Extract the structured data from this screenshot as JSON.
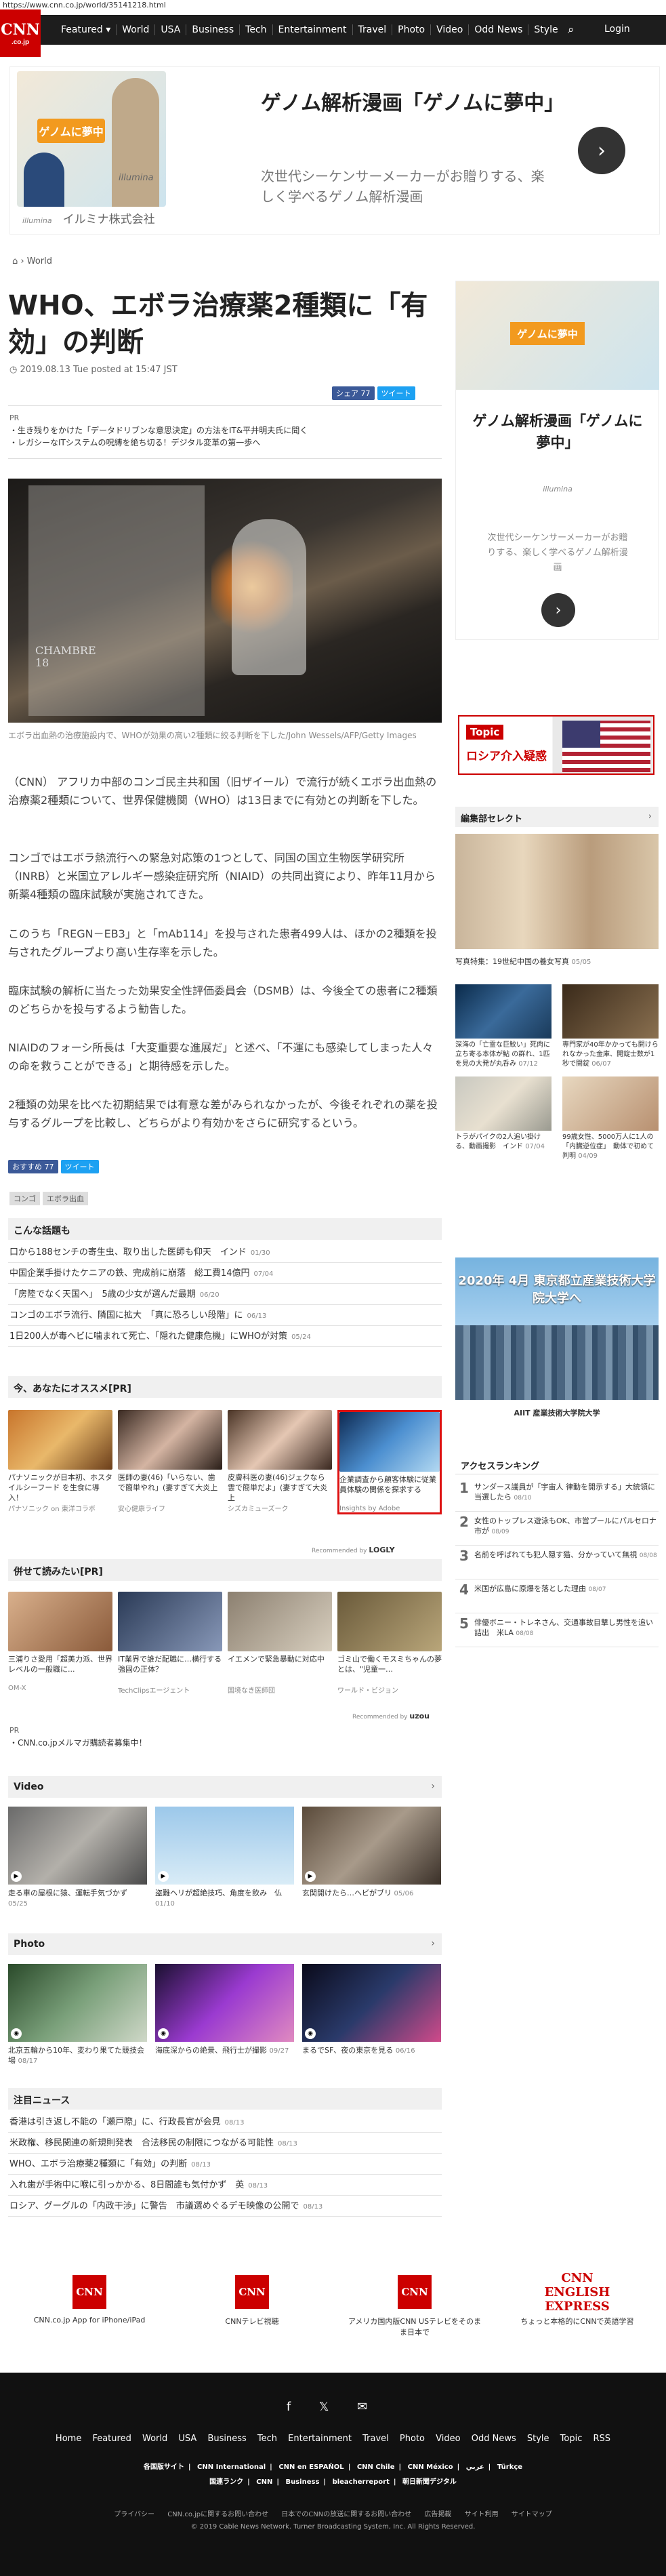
{
  "url": "https://www.cnn.co.jp/world/35141218.html",
  "nav": {
    "logo": "CNN",
    "logo_sub": ".co.jp",
    "links": [
      "Featured ▾",
      "World",
      "USA",
      "Business",
      "Tech",
      "Entertainment",
      "Travel",
      "Photo",
      "Video",
      "Odd News",
      "Style"
    ],
    "login": "Login"
  },
  "top_ad": {
    "banner": "ゲノムに夢中",
    "illumina": "illumina",
    "title": "ゲノム解析漫画「ゲノムに夢中」",
    "desc": "次世代シーケンサーメーカーがお贈りする、楽しく学べるゲノム解析漫画",
    "brand_small": "illumina",
    "brand": "イルミナ株式会社"
  },
  "breadcrumb": "World",
  "article": {
    "title": "WHO、エボラ治療薬2種類に「有効」の判断",
    "date": "2019.08.13 Tue posted at 15:47 JST",
    "share_fb": "シェア 77",
    "share_tw": "ツイート",
    "pr_label": "PR",
    "pr_items": [
      "・生き残りをかけた「データドリブンな意思決定」の方法をIT&平井明夫氏に聞く",
      "・レガシーなITシステムの呪縛を絶ち切る！デジタル変革の第一歩へ"
    ],
    "photo_text": "CHAMBRE\n18",
    "caption": "エボラ出血熱の治療施設内で、WHOが効果の高い2種類に絞る判断を下した/John Wessels/AFP/Getty Images",
    "paragraphs": [
      "（CNN） アフリカ中部のコンゴ民主共和国（旧ザイール）で流行が続くエボラ出血熱の治療薬2種類について、世界保健機関（WHO）は13日までに有効との判断を下した。",
      "コンゴではエボラ熱流行への緊急対応策の1つとして、同国の国立生物医学研究所（INRB）と米国立アレルギー感染症研究所（NIAID）の共同出資により、昨年11月から新薬4種類の臨床試験が実施されてきた。",
      "このうち「REGN－EB3」と「mAb114」を投与された患者499人は、ほかの2種類を投与されたグループより高い生存率を示した。",
      "臨床試験の解析に当たった効果安全性評価委員会（DSMB）は、今後全ての患者に2種類のどちらかを投与するよう勧告した。",
      "NIAIDのフォーシ所長は「大変重要な進展だ」と述べ、「不運にも感染してしまった人々の命を救うことができる」と期待感を示した。",
      "2種類の効果を比べた初期結果では有意な差がみられなかったが、今後それぞれの薬を投与するグループを比較し、どちらがより有効かをさらに研究するという。"
    ],
    "share_fb2": "おすすめ 77",
    "share_tw2": "ツイート",
    "tags": [
      "コンゴ",
      "エボラ出血"
    ]
  },
  "related": {
    "title": "こんな話題も",
    "items": [
      {
        "t": "口から188センチの寄生虫、取り出した医師も仰天　インド",
        "d": "01/30"
      },
      {
        "t": "中国企業手掛けたケニアの鉄、完成前に崩落　総工費14億円",
        "d": "07/04"
      },
      {
        "t": "「房陸でなく天国へ」　5歳の少女が選んだ最期",
        "d": "06/20"
      },
      {
        "t": "コンゴのエボラ流行、隣国に拡大　「真に恐ろしい段階」に",
        "d": "06/13"
      },
      {
        "t": "1日200人が毒ヘビに噛まれて死亡、「隠れた健康危機」にWHOが対策",
        "d": "05/24"
      }
    ]
  },
  "recommend": {
    "title": "今、あなたにオススメ[PR]",
    "items": [
      {
        "t": "パナソニックが日本初、ホスタイルシーフード を生食に導入！",
        "s": "パナソニック on 東洋コラボ"
      },
      {
        "t": "医師の妻(46)「いらない、歯で簡単やれ」(妻すぎて大炎上",
        "s": "安心健康ライフ"
      },
      {
        "t": "皮膚科医の妻(46)ジェクなら雲で簡単だよ」(妻すぎて大炎上",
        "s": "シズカミューズーク"
      },
      {
        "t": "企業調査から顧客体験に従業員体験の関係を探求する",
        "s": "Insights by Adobe"
      }
    ],
    "footer": "Recommended by",
    "footer_brand": "LOGLY"
  },
  "also": {
    "title": "併せて読みたい[PR]",
    "items": [
      {
        "t": "三浦りさ愛用「超美力派、世界レベルの一般職に...",
        "s": "OM-X"
      },
      {
        "t": "IT業界で誰だ配職に…横行する強固の正体？",
        "s": "TechClipsエージェント"
      },
      {
        "t": "イエメンで緊急暴動に対応中",
        "s": "国境なき医師団"
      },
      {
        "t": "ゴミ山で働くモスミちゃんの夢とは、\"児童一…",
        "s": "ワールド・ビジョン"
      }
    ],
    "footer": "Recommended by",
    "footer_brand": "uzou"
  },
  "pr_link": {
    "label": "PR",
    "text": "・CNN.co.jpメルマガ購読者募集中！"
  },
  "video": {
    "title": "Video",
    "items": [
      {
        "t": "走る車の屋根に猿、運転手気づかず",
        "d": "05/25"
      },
      {
        "t": "盗難ヘリが超絶技巧、角度を飲み　仏",
        "d": "01/10"
      },
      {
        "t": "玄関開けたら…ヘビがブリ",
        "d": "05/06"
      }
    ]
  },
  "photo": {
    "title": "Photo",
    "items": [
      {
        "t": "北京五輪から10年、変わり果てた競技会場",
        "d": "08/17"
      },
      {
        "t": "海底深からの絶景、飛行士が撮影",
        "d": "09/27"
      },
      {
        "t": "まるでSF、夜の東京を見る",
        "d": "06/16"
      }
    ]
  },
  "attention": {
    "title": "注目ニュース",
    "items": [
      {
        "t": "香港は引き返し不能の「瀬戸際」に、行政長官が会見",
        "d": "08/13"
      },
      {
        "t": "米政権、移民関連の新規則発表　合法移民の制限につながる可能性",
        "d": "08/13"
      },
      {
        "t": "WHO、エボラ治療薬2種類に「有効」の判断",
        "d": "08/13"
      },
      {
        "t": "入れ歯が手術中に喉に引っかかる、8日間誰も気付かず　英",
        "d": "08/13"
      },
      {
        "t": "ロシア、グーグルの「内政干渉」に警告　市議選めぐるデモ映像の公開で",
        "d": "08/13"
      }
    ]
  },
  "side_ad": {
    "banner": "ゲノムに夢中",
    "title": "ゲノム解析漫画「ゲノムに夢中」",
    "illumina": "illumina",
    "desc": "次世代シーケンサーメーカーがお贈りする、楽しく学べるゲノム解析漫画"
  },
  "topic": {
    "l1": "Topic",
    "l2": "ロシア介入疑惑"
  },
  "editor": {
    "title": "編集部セレクト",
    "big_caption": "写真特集：19世紀中国の養女写真",
    "big_date": "05/05",
    "items": [
      {
        "t": "深海の「亡霊な巨鮫い」死肉に立ち寄る本体が鮎 の群れ、1匹を見の大発が丸呑み",
        "d": "07/12"
      },
      {
        "t": "専門家が40年かかっても開けられなかった金庫、開錠士数が1秒で開錠",
        "d": "06/07"
      },
      {
        "t": "トラがパイクの2人追い掛ける、動画撮影　インド",
        "d": "07/04"
      },
      {
        "t": "99歳女性、5000万人に1人の「内臓逆位症」　動体で初めて判明",
        "d": "04/09"
      }
    ]
  },
  "big_ad": {
    "t": "2020年 4月 東京都立産業技術大学院大学へ",
    "bot": "AIIT 産業技術大学院大学"
  },
  "ranking": {
    "title": "アクセスランキング",
    "items": [
      {
        "t": "サンダース議員が「宇宙人 律動を開示する」大統領に当選したら",
        "d": "08/10"
      },
      {
        "t": "女性のトップレス遊泳もOK、市営プールにパルセロナ市が",
        "d": "08/09"
      },
      {
        "t": "名前を呼ばれても犯人隠す猫、分かっていて無視",
        "d": "08/08"
      },
      {
        "t": "米国が広島に原爆を落とした理由",
        "d": "08/07"
      },
      {
        "t": "俳優ボニー・トレネさん、交通事故目撃し男性を追い詰出　米LA",
        "d": "08/08"
      }
    ]
  },
  "apps": [
    {
      "i": "CNN",
      "t": "CNN.co.jp App for iPhone/iPad"
    },
    {
      "i": "CNN",
      "t": "CNNテレビ視聴"
    },
    {
      "i": "CNN",
      "t": "アメリカ国内版CNN USテレビをそのまま日本で"
    },
    {
      "i": "CNN ENGLISH EXPRESS",
      "t": "ちょっと本格的にCNNで英語学習"
    }
  ],
  "footer": {
    "social": "f  𝕏  ✉",
    "links": [
      "Home",
      "Featured",
      "World",
      "USA",
      "Business",
      "Tech",
      "Entertainment",
      "Travel",
      "Photo",
      "Video",
      "Odd News",
      "Style",
      "Topic",
      "RSS"
    ],
    "editions": [
      "各国版サイト",
      "CNN International",
      "CNN en ESPAÑOL",
      "CNN Chile",
      "CNN México",
      "عربي",
      "Türkçe"
    ],
    "editions2": [
      "国連ランク",
      "CNN",
      "Business",
      "bleacherreport",
      "朝日新聞デジタル"
    ],
    "small": [
      "プライバシー",
      "CNN.co.jpに関するお問い合わせ",
      "日本でのCNNの放送に関するお問い合わせ",
      "広告掲載",
      "サイト利用",
      "サイトマップ"
    ],
    "copy": "© 2019 Cable News Network.  Turner Broadcasting System, Inc.  All Rights Reserved."
  }
}
